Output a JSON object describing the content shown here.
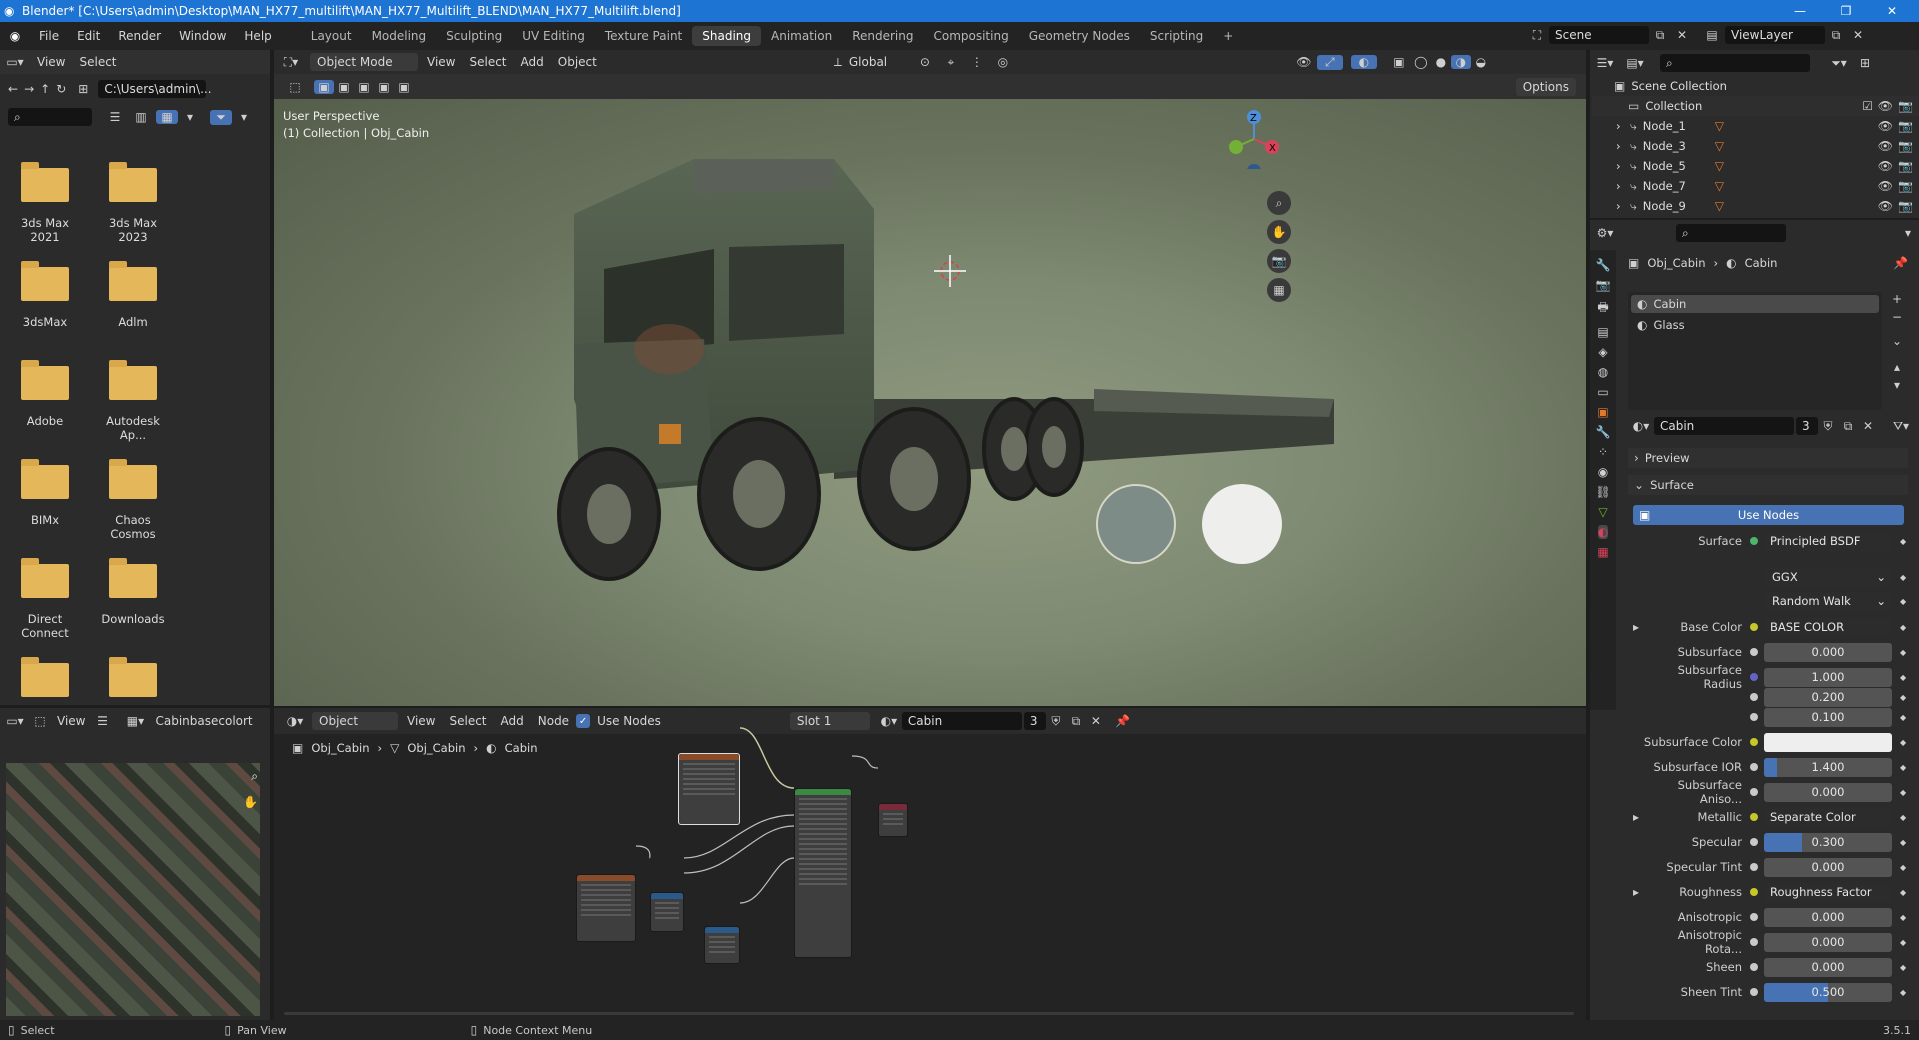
{
  "title_bar": {
    "text": "Blender* [C:\\Users\\admin\\Desktop\\MAN_HX77_multilift\\MAN_HX77_Multilift_BLEND\\MAN_HX77_Multilift.blend]"
  },
  "menu": {
    "items": [
      "File",
      "Edit",
      "Render",
      "Window",
      "Help"
    ]
  },
  "workspaces": [
    "Layout",
    "Modeling",
    "Sculpting",
    "UV Editing",
    "Texture Paint",
    "Shading",
    "Animation",
    "Rendering",
    "Compositing",
    "Geometry Nodes",
    "Scripting"
  ],
  "active_workspace": "Shading",
  "scene": {
    "name": "Scene",
    "view_layer": "ViewLayer"
  },
  "file_browser": {
    "view": "View",
    "select": "Select",
    "path": "C:\\Users\\admin\\...",
    "folders": [
      "3ds Max 2021",
      "3ds Max 2023",
      "3dsMax",
      "Adlm",
      "Adobe",
      "Autodesk Ap...",
      "BIMx",
      "Chaos Cosmos",
      "Direct Connect",
      "Downloads",
      "",
      ""
    ]
  },
  "viewport": {
    "mode": "Object Mode",
    "view": "View",
    "select": "Select",
    "add": "Add",
    "object": "Object",
    "orientation": "Global",
    "options": "Options",
    "info_line1": "User Perspective",
    "info_line2": "(1) Collection | Obj_Cabin"
  },
  "image_editor": {
    "view": "View",
    "image_name": "Cabinbasecolort"
  },
  "node_editor": {
    "object": "Object",
    "view": "View",
    "select": "Select",
    "add": "Add",
    "node": "Node",
    "use_nodes": "Use Nodes",
    "slot": "Slot 1",
    "material": "Cabin",
    "users": "3",
    "breadcrumb": [
      "Obj_Cabin",
      "Obj_Cabin",
      "Cabin"
    ]
  },
  "outliner": {
    "scene_collection": "Scene Collection",
    "collection": "Collection",
    "nodes": [
      "Node_1",
      "Node_3",
      "Node_5",
      "Node_7",
      "Node_9"
    ]
  },
  "properties": {
    "breadcrumb": [
      "Obj_Cabin",
      "Cabin"
    ],
    "materials": [
      "Cabin",
      "Glass"
    ],
    "material_name": "Cabin",
    "users": "3",
    "preview": "Preview",
    "surface_section": "Surface",
    "use_nodes_btn": "Use Nodes",
    "rows": [
      {
        "label": "Surface",
        "value": "Principled BSDF",
        "type": "link",
        "dot": "#4fb36b"
      },
      {
        "label": "",
        "value": "GGX",
        "type": "dropdown"
      },
      {
        "label": "",
        "value": "Random Walk",
        "type": "dropdown"
      },
      {
        "label": "Base Color",
        "value": "BASE COLOR",
        "type": "link",
        "dot": "#c7c729",
        "expand": true
      },
      {
        "label": "Subsurface",
        "value": "0.000",
        "type": "num",
        "fill": 0
      },
      {
        "label": "Subsurface Radius",
        "value": "1.000",
        "type": "num",
        "fill": 0,
        "dot": "#6363c7"
      },
      {
        "label": "",
        "value": "0.200",
        "type": "num",
        "fill": 0
      },
      {
        "label": "",
        "value": "0.100",
        "type": "num",
        "fill": 0
      },
      {
        "label": "Subsurface Color",
        "value": "",
        "type": "color",
        "dot": "#c7c729"
      },
      {
        "label": "Subsurface IOR",
        "value": "1.400",
        "type": "num",
        "fill": 0.1
      },
      {
        "label": "Subsurface Aniso...",
        "value": "0.000",
        "type": "num",
        "fill": 0
      },
      {
        "label": "Metallic",
        "value": "Separate Color",
        "type": "link",
        "dot": "#c7c729",
        "expand": true
      },
      {
        "label": "Specular",
        "value": "0.300",
        "type": "num",
        "fill": 0.3
      },
      {
        "label": "Specular Tint",
        "value": "0.000",
        "type": "num",
        "fill": 0
      },
      {
        "label": "Roughness",
        "value": "Roughness Factor",
        "type": "link",
        "dot": "#c7c729",
        "expand": true
      },
      {
        "label": "Anisotropic",
        "value": "0.000",
        "type": "num",
        "fill": 0
      },
      {
        "label": "Anisotropic Rota...",
        "value": "0.000",
        "type": "num",
        "fill": 0
      },
      {
        "label": "Sheen",
        "value": "0.000",
        "type": "num",
        "fill": 0
      },
      {
        "label": "Sheen Tint",
        "value": "0.500",
        "type": "num",
        "fill": 0.5
      }
    ]
  },
  "status": {
    "select": "Select",
    "pan": "Pan View",
    "context": "Node Context Menu",
    "version": "3.5.1"
  }
}
